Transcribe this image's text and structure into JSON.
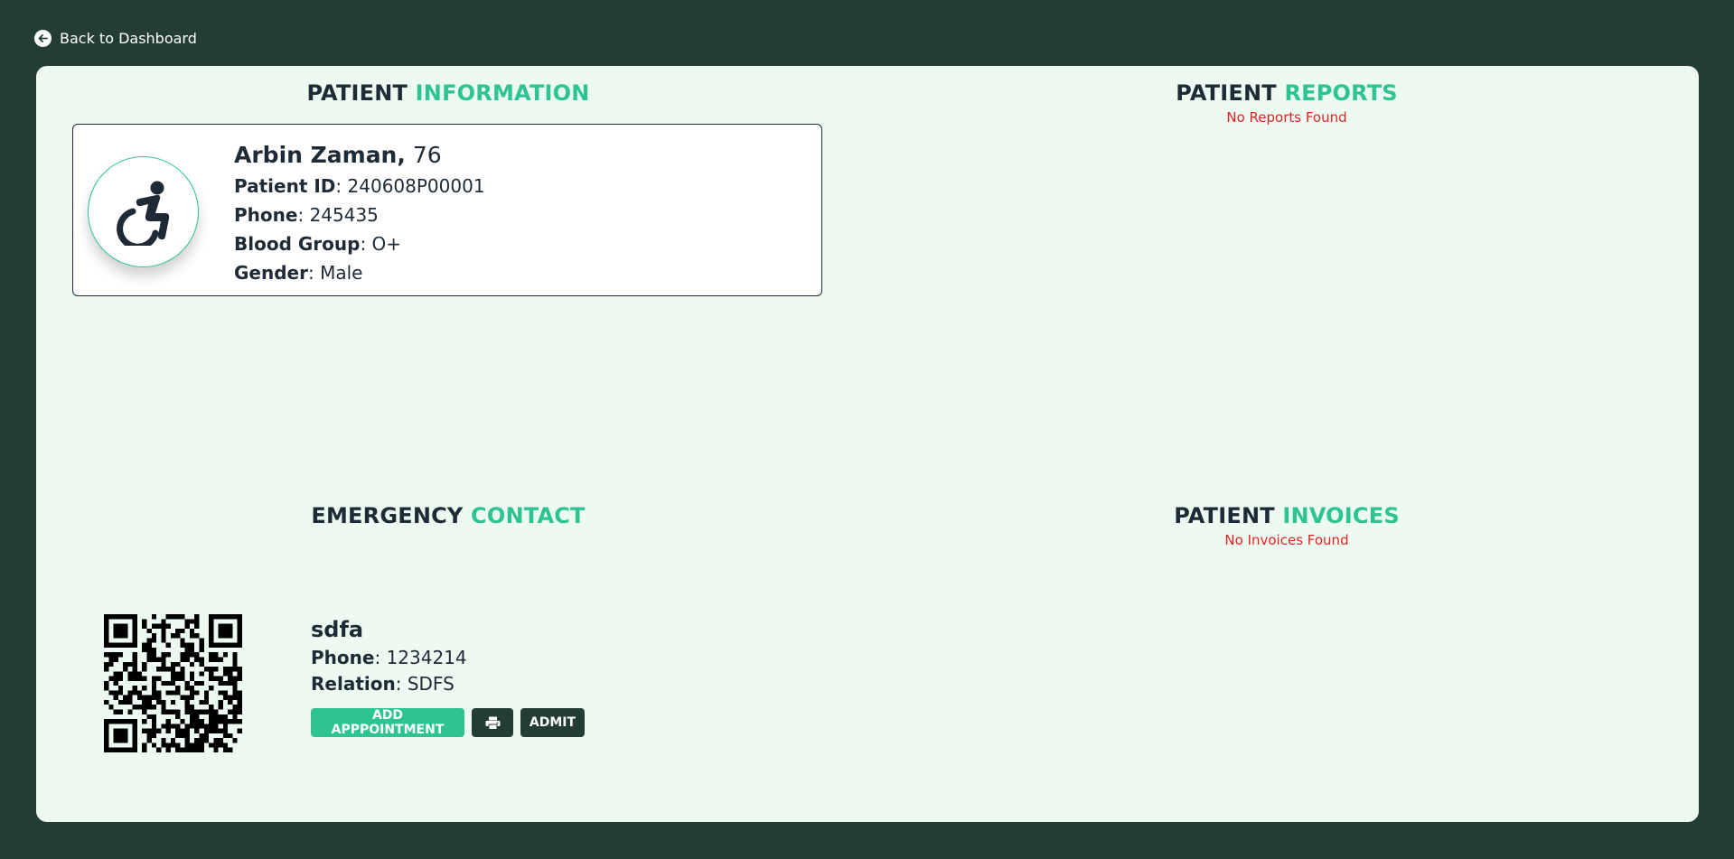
{
  "nav": {
    "back_label": "Back to Dashboard"
  },
  "patient_info": {
    "title_main": "PATIENT",
    "title_accent": "INFORMATION",
    "name": "Arbin Zaman,",
    "age": "76",
    "fields": {
      "id_label": "Patient ID",
      "id_value": "240608P00001",
      "phone_label": "Phone",
      "phone_value": "245435",
      "blood_label": "Blood Group",
      "blood_value": "O+",
      "gender_label": "Gender",
      "gender_value": "Male"
    },
    "avatar_icon": "wheelchair-icon"
  },
  "reports": {
    "title_main": "PATIENT",
    "title_accent": "REPORTS",
    "empty_text": "No Reports Found"
  },
  "emergency": {
    "title_main": "EMERGENCY",
    "title_accent": "CONTACT",
    "name": "sdfa",
    "phone_label": "Phone",
    "phone_value": "1234214",
    "relation_label": "Relation",
    "relation_value": "SDFS",
    "qr_icon": "qr-code"
  },
  "invoices": {
    "title_main": "PATIENT",
    "title_accent": "INVOICES",
    "empty_text": "No Invoices Found"
  },
  "actions": {
    "add_appointment_label": "ADD APPPOINTMENT",
    "print_icon": "printer-icon",
    "admit_label": "ADMIT"
  },
  "colors": {
    "background": "#233d35",
    "panel": "#edfaf2",
    "accent": "#2ec491",
    "text": "#1f2a37",
    "error": "#e02424"
  }
}
